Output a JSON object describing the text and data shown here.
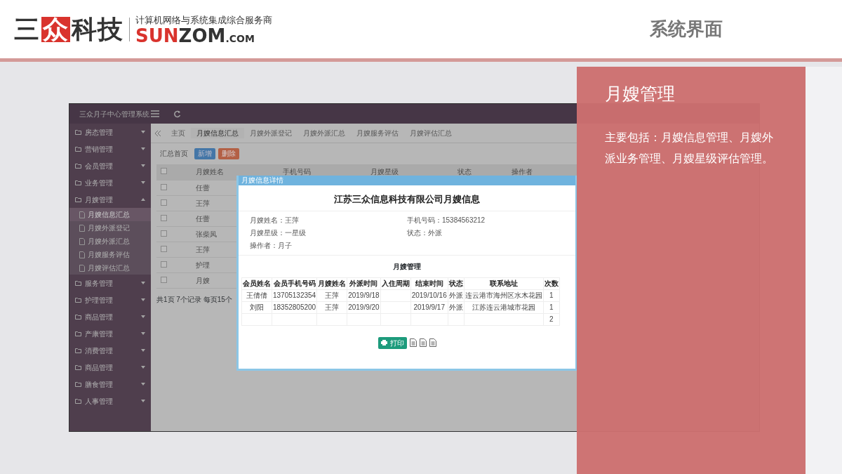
{
  "header": {
    "logo": {
      "before": "三",
      "boxed": "众",
      "after": "科技"
    },
    "tagline": "计算机网络与系统集成综合服务商",
    "domain": {
      "red": "SUN",
      "dark": "ZOM",
      "suffix": ".COM"
    },
    "slide_title": "系统界面"
  },
  "app": {
    "title": "三众月子中心管理系统",
    "sidebar": [
      {
        "label": "房态管理",
        "expanded": false
      },
      {
        "label": "营销管理",
        "expanded": false
      },
      {
        "label": "会员管理",
        "expanded": false
      },
      {
        "label": "业务管理",
        "expanded": false
      },
      {
        "label": "月嫂管理",
        "expanded": true,
        "children": [
          {
            "label": "月嫂信息汇总",
            "selected": true
          },
          {
            "label": "月嫂外派登记",
            "selected": false
          },
          {
            "label": "月嫂外派汇总",
            "selected": false
          },
          {
            "label": "月嫂服务评估",
            "selected": false
          },
          {
            "label": "月嫂评估汇总",
            "selected": false
          }
        ]
      },
      {
        "label": "服务管理",
        "expanded": false
      },
      {
        "label": "护理管理",
        "expanded": false
      },
      {
        "label": "商品管理",
        "expanded": false
      },
      {
        "label": "产康管理",
        "expanded": false
      },
      {
        "label": "消费管理",
        "expanded": false
      },
      {
        "label": "商品管理",
        "expanded": false
      },
      {
        "label": "膳食管理",
        "expanded": false
      },
      {
        "label": "人事管理",
        "expanded": false
      }
    ],
    "tabs": [
      {
        "label": "主页",
        "selected": false
      },
      {
        "label": "月嫂信息汇总",
        "selected": true
      },
      {
        "label": "月嫂外派登记",
        "selected": false
      },
      {
        "label": "月嫂外派汇总",
        "selected": false
      },
      {
        "label": "月嫂服务评估",
        "selected": false
      },
      {
        "label": "月嫂评估汇总",
        "selected": false
      }
    ],
    "toolbar": [
      {
        "label": "汇总首页",
        "kind": "plain"
      },
      {
        "label": "新增",
        "kind": "add"
      },
      {
        "label": "删除",
        "kind": "delete"
      }
    ],
    "table": {
      "columns": [
        "月嫂姓名",
        "手机号码",
        "月嫂星级",
        "状态",
        "操作者"
      ],
      "all_checked": false,
      "rows": [
        {
          "name": "任蕾",
          "checked": false
        },
        {
          "name": "王萍",
          "checked": false
        },
        {
          "name": "任蕾",
          "checked": false
        },
        {
          "name": "张柴凤",
          "checked": false
        },
        {
          "name": "王萍",
          "checked": false
        },
        {
          "name": "护理",
          "checked": false
        },
        {
          "name": "月嫂",
          "checked": false
        }
      ]
    },
    "pager": "共1页 7个记录 每页15个",
    "modal": {
      "title": "月嫂信息详情",
      "heading": "江苏三众信息科技有限公司月嫂信息",
      "fields": [
        {
          "label": "月嫂姓名：",
          "value": "王萍"
        },
        {
          "label": "手机号码：",
          "value": "15384563212"
        },
        {
          "label": "月嫂星级：",
          "value": "一星级"
        },
        {
          "label": "状态：",
          "value": "外派"
        },
        {
          "label": "操作者：",
          "value": "月子"
        }
      ],
      "section": "月嫂管理",
      "columns": [
        "会员姓名",
        "会员手机号码",
        "月嫂姓名",
        "外派时间",
        "入住周期",
        "结束时间",
        "状态",
        "联系地址",
        "次数"
      ],
      "rows": [
        {
          "member_name": "王倩倩",
          "member_phone": "13705132354",
          "nanny_name": "王萍",
          "dispatch_time": "2019/9/18",
          "end_time": "2019/10/16",
          "status": "外派",
          "address": "连云港市海州区水木花园",
          "count": "1"
        },
        {
          "member_name": "刘阳",
          "member_phone": "18352805200",
          "nanny_name": "王萍",
          "dispatch_time": "2019/9/20",
          "end_time": "2019/9/17",
          "status": "外派",
          "address": "江苏连云港城市花园",
          "count": "1"
        },
        {
          "count": "2"
        }
      ],
      "print": "打印"
    }
  },
  "panel": {
    "title": "月嫂管理",
    "body": "主要包括：月嫂信息管理、月嫂外派业务管理、月嫂星级评估管理。"
  }
}
